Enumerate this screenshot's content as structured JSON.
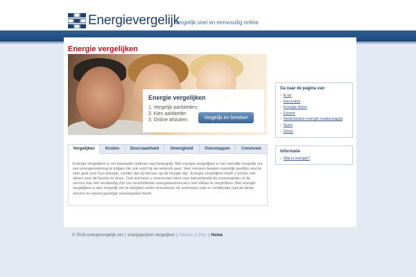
{
  "header": {
    "logo_text": "Energievergelijk",
    "tagline": "Vergelijk snel en eenvoudig online"
  },
  "main": {
    "title": "Energie vergelijken",
    "hero": {
      "box_title": "Energie vergelijken",
      "steps": [
        "1. Vergelijk aanbieders",
        "2. Kies aanbieder",
        "3. Online afsluiten"
      ],
      "button_label": "Vergelijk en bereken"
    },
    "tabs": [
      {
        "label": "Vergelijken",
        "active": true
      },
      {
        "label": "Kosten",
        "active": false
      },
      {
        "label": "Duurzaamheid",
        "active": false
      },
      {
        "label": "Onenigheid",
        "active": false
      },
      {
        "label": "Overstappen",
        "active": false
      },
      {
        "label": "Conclusie",
        "active": false
      }
    ],
    "tab_text": "Energie vergelijken is om bepaalde redenen erg belangrijk. Met energie vergelijken is het namelijk mogelijk om een energierekening te krijgen die ook echt bij uw verbruik past. Veel mensen betalen namelijk jaarlijks veel te veel geld voor hun energie, zonder dat zij hiervan op de hoogte zijn. Energie vergelijken hoeft u echter niet alleen voor de kosten te doen. Ook wanneer u ontevreden bent over bijvoorbeeld de voorwaarden of de service kan het verstandig zijn om verschillende energieleveranciers met elkaar te vergelijken. Met energie vergelijken is dus mogelijk om te bekijken welke leverancier de scherpste prijs in combinatie met de beste service en meest gunstige voorwaarden heeft."
  },
  "sidebar": {
    "nav": {
      "title": "Ga naar de pagina van",
      "items": [
        "E-on",
        "Electrabel",
        "Energie direct",
        "Essent",
        "Nederlandse energie maatschappij",
        "Nuon",
        "Oxxio"
      ]
    },
    "info": {
      "title": "Informatie",
      "items": [
        "Wat is energie?"
      ]
    }
  },
  "footer": {
    "copyright": "© 2016 energievergelijk.net",
    "sep": "|",
    "prices": "energieprijzen vergelijken",
    "news": "Nieuws",
    "links": "links",
    "home": "Home"
  }
}
